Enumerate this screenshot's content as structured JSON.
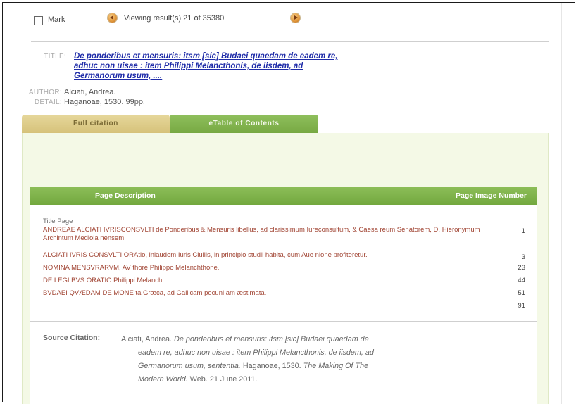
{
  "toolbar": {
    "mark_label": "Mark",
    "viewing_text": "Viewing result(s) 21 of 35380"
  },
  "record": {
    "title_label": "TITLE:",
    "title_line1": "De ponderibus et mensuris: itsm [sic] Budaei quaedam de eadem re,",
    "title_line2": "adhuc non uisae : item Philippi Melancthonis, de iisdem, ad",
    "title_line3": "Germanorum usum, ....",
    "author_label": "AUTHOR:",
    "author": "Alciati, Andrea.",
    "detail_label": "DETAIL:",
    "detail": "Haganoae, 1530. 99pp."
  },
  "tabs": [
    {
      "label": "Full citation",
      "active": false
    },
    {
      "label": "eTable of Contents",
      "active": true
    }
  ],
  "toc": {
    "col_description": "Page Description",
    "col_image_number": "Page Image Number",
    "rows": [
      {
        "text": "Title Page",
        "page": ""
      },
      {
        "text": "ANDREAE ALCIATI IVRISCONSVLTI de Ponderibus & Mensuris libellus, ad clarissimum Iureconsultum, & Caesa reum Senatorem, D. Hieronymum Archintum Mediola nensem.",
        "page": "1"
      },
      {
        "text": "ALCIATI IVRIS CONSVLTI ORAtio, inlaudem Iuris Ciuilis, in principio studii habita, cum Aue nione profiteretur.",
        "page": "3"
      },
      {
        "text": "NOMINA MENSVRARVM, AV thore Philippo Melanchthone.",
        "page": "23"
      },
      {
        "text": "DE LEGI BVS ORATIO Philippi Melanch.",
        "page": "44"
      },
      {
        "text": "BVDAEI QVÆDAM DE MONE ta Græca, ad Gallicam pecuni am æstimata.",
        "page": "51"
      },
      {
        "text": "",
        "page": "91"
      }
    ]
  },
  "citation": {
    "label": "Source Citation:",
    "line1_plain": "Alciati, Andrea. ",
    "line1_italic": "De ponderibus et mensuris: itsm [sic] Budaei quaedam de",
    "line2_italic": "eadem re, adhuc non uisae : item Philippi Melancthonis, de iisdem, ad",
    "line3_italic": "Germanorum usum, sententia.",
    "line3_plain": " Haganoae, 1530. ",
    "line3_italic2": "The Making Of The",
    "line4_italic": "Modern World.",
    "line4_plain": " Web. 21 June 2011."
  },
  "colors": {
    "tab_active": "#77a943",
    "tab_inactive": "#d6c27a",
    "title_link": "#1f2ca8",
    "toc_link": "#a14534",
    "panel_bg": "#f4f9e6"
  },
  "icons": {
    "prev": "prev-arrow-icon",
    "next": "next-arrow-icon"
  }
}
